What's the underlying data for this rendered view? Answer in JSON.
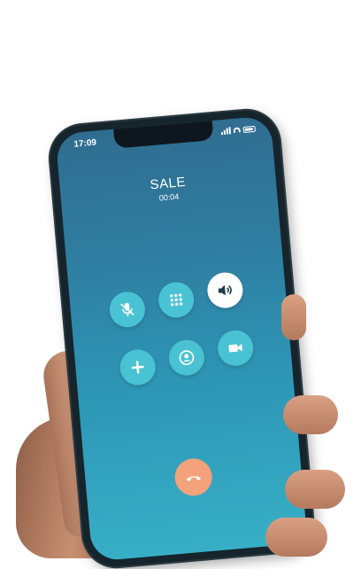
{
  "status_bar": {
    "time": "17:09"
  },
  "call": {
    "caller": "SALE",
    "duration": "00:04"
  },
  "controls": [
    {
      "icon": "mic-off-icon",
      "active": false
    },
    {
      "icon": "keypad-icon",
      "active": false
    },
    {
      "icon": "speaker-icon",
      "active": true
    },
    {
      "icon": "add-call-icon",
      "active": false
    },
    {
      "icon": "contacts-icon",
      "active": false
    },
    {
      "icon": "video-icon",
      "active": false
    }
  ],
  "end_call": {
    "icon": "end-call-icon"
  },
  "colors": {
    "button": "#49c3d3",
    "active_button": "#ffffff",
    "end_call": "#f3a27b",
    "screen_top": "#2f6d90",
    "screen_bottom": "#37afc6"
  }
}
